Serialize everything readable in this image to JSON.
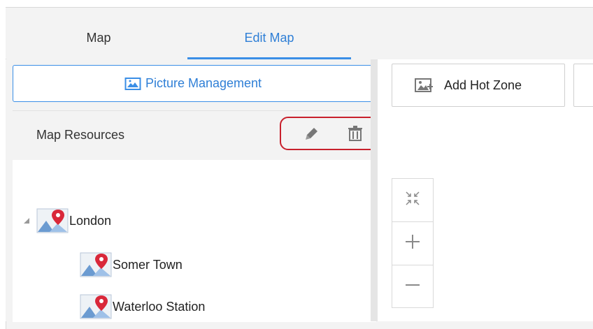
{
  "tabs": [
    {
      "label": "Map",
      "active": false
    },
    {
      "label": "Edit Map",
      "active": true
    }
  ],
  "left_panel": {
    "picture_management_label": "Picture Management",
    "resources_title": "Map Resources",
    "tools": {
      "edit": "pencil-icon",
      "delete": "trash-icon"
    },
    "tree": {
      "root": {
        "label": "London",
        "expanded": true
      },
      "children": [
        {
          "label": "Somer Town"
        },
        {
          "label": "Waterloo Station"
        }
      ]
    }
  },
  "right_panel": {
    "add_hot_zone_label": "Add Hot Zone",
    "zoom_controls": [
      "fit-screen-icon",
      "zoom-in-icon",
      "zoom-out-icon"
    ]
  },
  "colors": {
    "accent": "#3a8ee6",
    "highlight_border": "#c8202c",
    "map_pin": "#d9283a",
    "icon_gray": "#6f6f6f"
  }
}
